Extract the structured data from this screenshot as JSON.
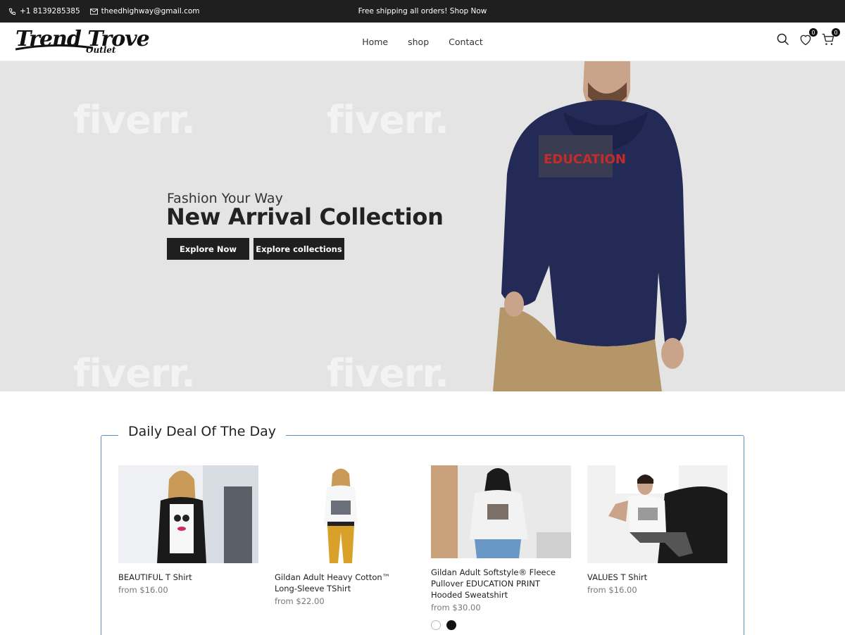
{
  "topbar": {
    "phone": "+1 8139285385",
    "email": "theedhighway@gmail.com",
    "promo": "Free shipping all orders! Shop Now"
  },
  "header": {
    "logo_line1": "Trend Trove",
    "logo_line2": "Outlet",
    "nav": [
      "Home",
      "shop",
      "Contact"
    ],
    "wishlist_count": "0",
    "cart_count": "0"
  },
  "hero": {
    "subtitle": "Fashion Your Way",
    "title": "New Arrival Collection",
    "button1": "Explore Now",
    "button2": "Explore collections",
    "watermark": "fiverr.",
    "shirt_print": "EDUCATION"
  },
  "deals": {
    "title": "Daily Deal Of The Day",
    "products": [
      {
        "name": "BEAUTIFUL T Shirt",
        "price_prefix": "from",
        "price": "$16.00"
      },
      {
        "name": "Gildan Adult Heavy Cotton™ Long-Sleeve TShirt",
        "price_prefix": "from",
        "price": "$22.00"
      },
      {
        "name": "Gildan Adult Softstyle® Fleece Pullover EDUCATION PRINT Hooded Sweatshirt",
        "price_prefix": "from",
        "price": "$30.00",
        "swatches": [
          "#ffffff",
          "#111111"
        ]
      },
      {
        "name": "VALUES T Shirt",
        "price_prefix": "from",
        "price": "$16.00"
      }
    ]
  },
  "colors": {
    "dark": "#1f1f1f",
    "hero_bg": "#e4e4e4",
    "deal_border": "#5b8fc7",
    "hoodie": "#232a55"
  }
}
